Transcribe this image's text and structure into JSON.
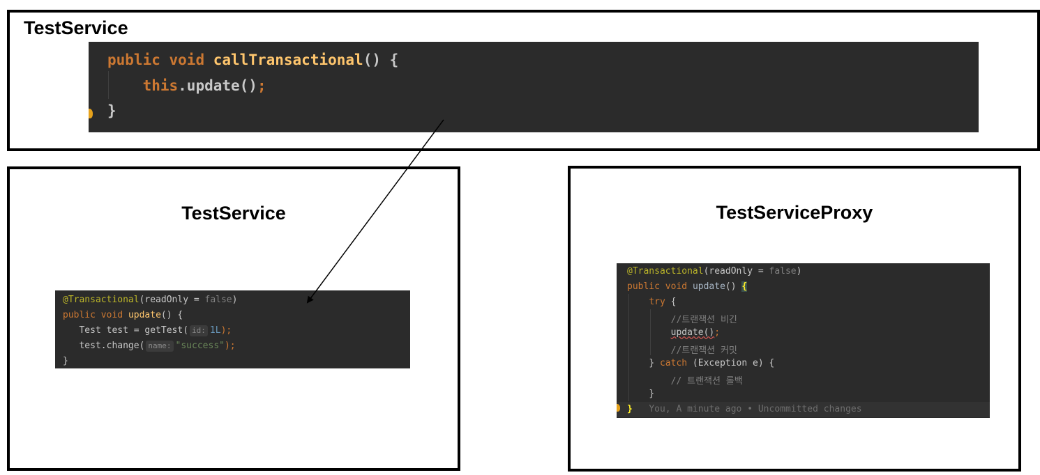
{
  "panels": {
    "top": {
      "title": "TestService",
      "code": {
        "line1": {
          "kw1": "public",
          "kw2": "void",
          "fn": "callTransactional",
          "rest": "() {"
        },
        "line2": {
          "kw": "this",
          "call": ".update()",
          "semi": ";"
        },
        "line3": {
          "brace": "}"
        }
      }
    },
    "left": {
      "title": "TestService",
      "code": {
        "line1": {
          "ann": "@Transactional",
          "open": "(readOnly = ",
          "val": "false",
          "close": ")"
        },
        "line2": {
          "kw1": "public",
          "kw2": "void",
          "fn": "update",
          "rest": "() {"
        },
        "line3": {
          "pre": "Test test = getTest(",
          "hint": "id:",
          "num": "1L",
          "post": ");"
        },
        "line4": {
          "pre": "test.change(",
          "hint": "name:",
          "str": "\"success\"",
          "post": ");"
        },
        "line5": {
          "brace": "}"
        }
      }
    },
    "right": {
      "title": "TestServiceProxy",
      "code": {
        "line1": {
          "ann": "@Transactional",
          "open": "(readOnly = ",
          "val": "false",
          "close": ")"
        },
        "line2": {
          "kw1": "public",
          "kw2": "void",
          "fn": "update",
          "rest": "() ",
          "brace": "{"
        },
        "line3": {
          "kw": "try",
          "rest": " {"
        },
        "line4": {
          "comment": "//트랜잭션 비긴"
        },
        "line5": {
          "call": "update()",
          "semi": ";"
        },
        "line6": {
          "comment": "//트랜잭션 커밋"
        },
        "line7": {
          "pre": "} ",
          "kw": "catch",
          "rest": " (Exception e) {"
        },
        "line8": {
          "comment": "// 트랜잭션 롤백"
        },
        "line9": {
          "brace": "}"
        },
        "line10": {
          "brace": "}",
          "blame": "You, A minute ago • Uncommitted changes"
        }
      }
    }
  },
  "colors": {
    "editor_bg": "#2b2b2b",
    "keyword": "#cc7832",
    "function": "#ffc66d",
    "annotation": "#bbb529",
    "number": "#6897bb",
    "string": "#6a8759",
    "comment": "#808080"
  },
  "icons": {
    "intention_bulb": "lightbulb-icon",
    "arrow": "arrow-icon"
  }
}
